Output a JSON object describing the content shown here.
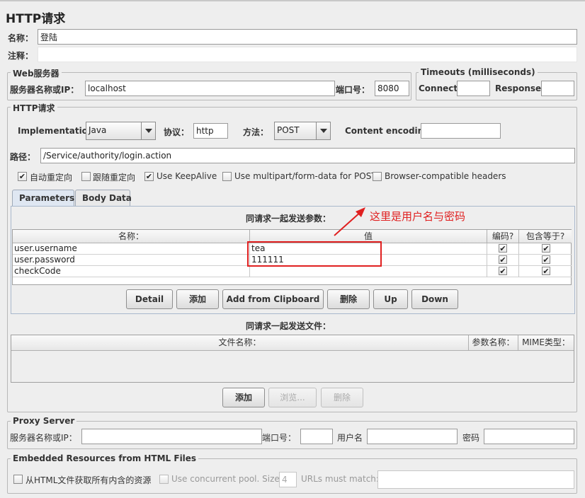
{
  "title": "HTTP请求",
  "name_label": "名称：",
  "name_value": "登陆",
  "comment_label": "注释：",
  "comment_value": "",
  "web_server": {
    "legend": "Web服务器",
    "server_label": "服务器名称或IP：",
    "server_value": "localhost",
    "port_label": "端口号：",
    "port_value": "8080"
  },
  "timeouts": {
    "legend": "Timeouts (milliseconds)",
    "connect_label": "Connect:",
    "connect_value": "",
    "response_label": "Response:",
    "response_value": ""
  },
  "http_request": {
    "legend": "HTTP请求",
    "implementation_label": "Implementation:",
    "implementation_value": "Java",
    "protocol_label": "协议：",
    "protocol_value": "http",
    "method_label": "方法：",
    "method_value": "POST",
    "encoding_label": "Content encoding:",
    "encoding_value": "",
    "path_label": "路径：",
    "path_value": "/Service/authority/login.action"
  },
  "options": [
    {
      "label": "自动重定向",
      "checked": true
    },
    {
      "label": "跟随重定向",
      "checked": false
    },
    {
      "label": "Use KeepAlive",
      "checked": true
    },
    {
      "label": "Use multipart/form-data for POST",
      "checked": false
    },
    {
      "label": "Browser-compatible headers",
      "checked": false
    }
  ],
  "tabs": [
    {
      "label": "Parameters",
      "active": true
    },
    {
      "label": "Body Data",
      "active": false
    }
  ],
  "params": {
    "caption": "同请求一起发送参数：",
    "headers": [
      "名称：",
      "值",
      "编码?",
      "包含等于?"
    ],
    "rows": [
      {
        "name": "user.username",
        "value": "tea",
        "encode": true,
        "include_equals": true
      },
      {
        "name": "user.password",
        "value": "111111",
        "encode": true,
        "include_equals": true
      },
      {
        "name": "checkCode",
        "value": "",
        "encode": true,
        "include_equals": true
      }
    ],
    "buttons": [
      "Detail",
      "添加",
      "Add from Clipboard",
      "删除",
      "Up",
      "Down"
    ]
  },
  "annotation": {
    "text": "这里是用户名与密码",
    "color": "#e02020"
  },
  "files": {
    "caption": "同请求一起发送文件：",
    "headers": [
      "文件名称：",
      "参数名称：",
      "MIME类型："
    ],
    "buttons": [
      {
        "label": "添加",
        "enabled": true
      },
      {
        "label": "浏览...",
        "enabled": false
      },
      {
        "label": "删除",
        "enabled": false
      }
    ]
  },
  "proxy": {
    "legend": "Proxy Server",
    "server_label": "服务器名称或IP：",
    "port_label": "端口号：",
    "user_label": "用户名",
    "password_label": "密码"
  },
  "embedded": {
    "legend": "Embedded Resources from HTML Files",
    "fetch_label": "从HTML文件获取所有内含的资源",
    "fetch_checked": false,
    "pool_label": "Use concurrent pool. Size:",
    "pool_checked": false,
    "pool_size": "4",
    "urls_label": "URLs must match:",
    "urls_value": ""
  }
}
